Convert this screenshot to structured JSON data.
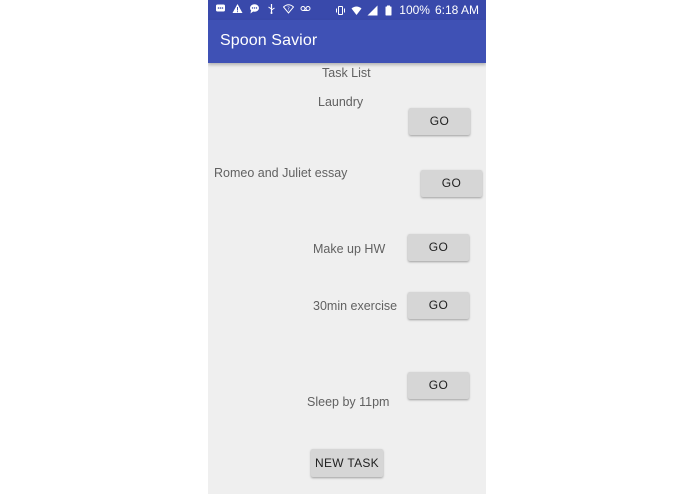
{
  "status_bar": {
    "battery_percent": "100%",
    "time": "6:18 AM",
    "left_icons": [
      "message-icon",
      "warning-icon",
      "chat-icon",
      "usb-icon",
      "wifi-question-icon",
      "voicemail-icon"
    ],
    "right_icons": [
      "vibrate-icon",
      "wifi-icon",
      "signal-icon",
      "battery-icon"
    ]
  },
  "app_bar": {
    "title": "Spoon Savior"
  },
  "main": {
    "heading": "Task List",
    "tasks": [
      {
        "label": "Laundry",
        "button_label": "GO"
      },
      {
        "label": "Romeo and Juliet essay",
        "button_label": "GO"
      },
      {
        "label": "Make up HW",
        "button_label": "GO"
      },
      {
        "label": "30min exercise",
        "button_label": "GO"
      },
      {
        "label": "Sleep by 11pm",
        "button_label": "GO"
      }
    ],
    "new_task_label": "NEW TASK"
  },
  "colors": {
    "primary": "#3f51b5",
    "primary_dark": "#3949ab",
    "background": "#efefef",
    "button": "#d6d6d6"
  }
}
